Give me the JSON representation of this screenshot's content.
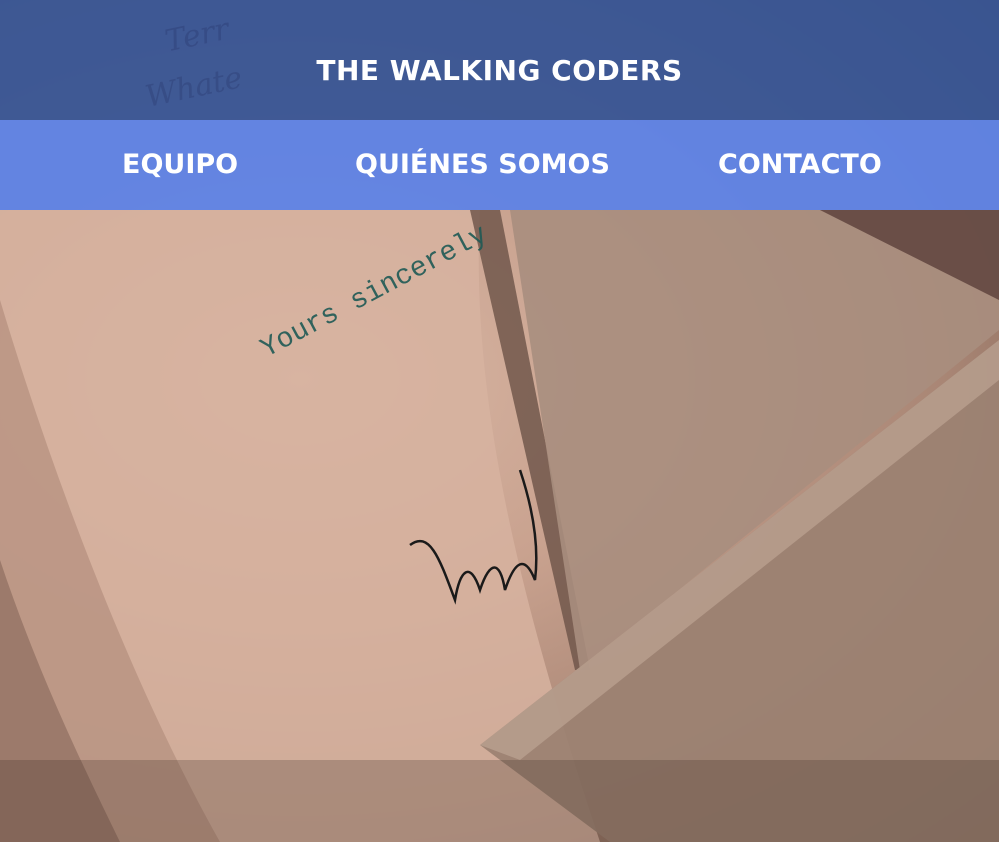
{
  "header": {
    "title": "THE WALKING CODERS"
  },
  "nav": {
    "items": [
      {
        "label": "EQUIPO"
      },
      {
        "label": "QUIÉNES SOMOS"
      },
      {
        "label": "CONTACTO"
      }
    ]
  },
  "hero": {
    "letter_text": "Yours sincerely",
    "faint_text_1": "Terr",
    "faint_text_2": "Whate"
  },
  "colors": {
    "header_bg": "#3f5a96",
    "nav_bg": "#5e83e6",
    "nav_text": "#ffffff"
  }
}
